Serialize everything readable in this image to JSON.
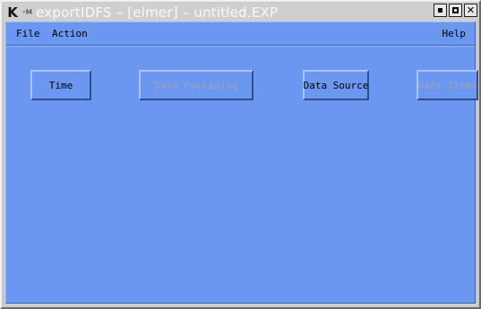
{
  "window": {
    "title": "exportIDFS – [elmer] – untitled.EXP",
    "system_icon_letter": "K",
    "system_icon_mark": "-ᴍ"
  },
  "menubar": {
    "file": "File",
    "action": "Action",
    "help": "Help"
  },
  "buttons": {
    "time": {
      "label": "Time",
      "enabled": true
    },
    "data_packaging": {
      "label": "Data Packaging",
      "enabled": false
    },
    "data_source": {
      "label": "Data Source",
      "enabled": true
    },
    "data_items": {
      "label": "Data Items",
      "enabled": false
    }
  },
  "colors": {
    "client_background": "#6b97f0",
    "frame": "#c8c8c8",
    "disabled_text": "#9aa3b5"
  }
}
